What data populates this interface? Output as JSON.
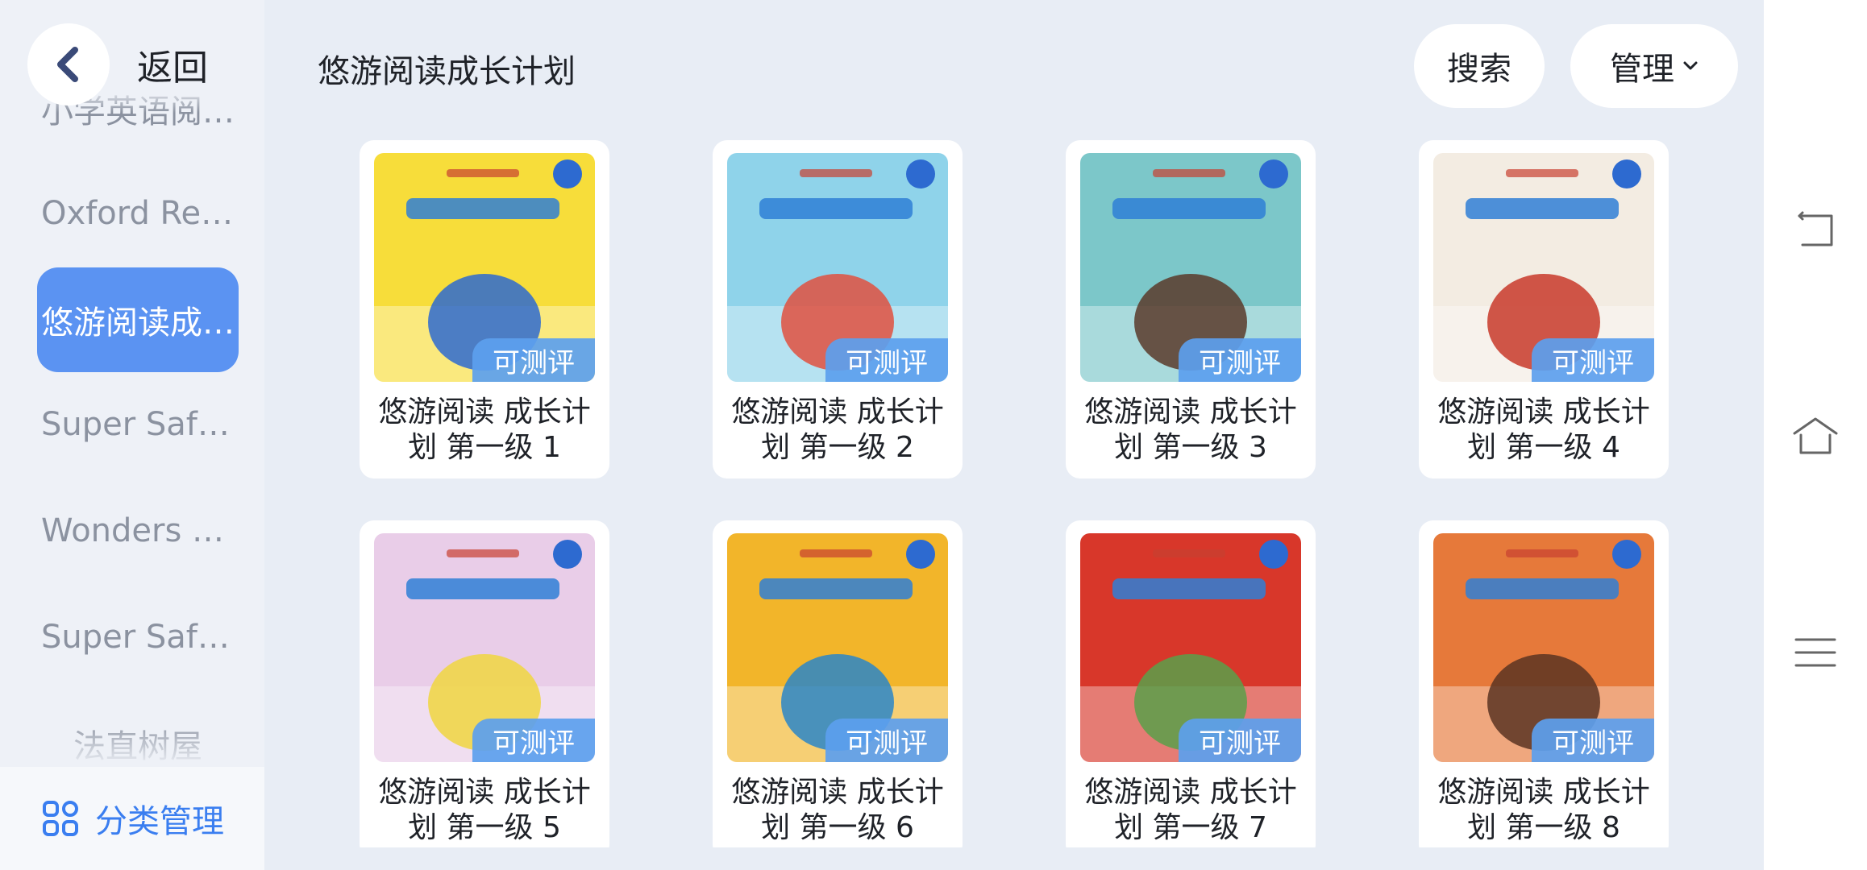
{
  "header": {
    "back_label": "返回",
    "title": "悠游阅读成长计划",
    "search_label": "搜索",
    "manage_label": "管理"
  },
  "sidebar": {
    "items": [
      {
        "label": "小学英语阅…"
      },
      {
        "label": "Oxford Rea…"
      },
      {
        "label": "悠游阅读成…",
        "active": true
      },
      {
        "label": "Super Safa…"
      },
      {
        "label": "Wonders R…"
      },
      {
        "label": "Super Safa…"
      },
      {
        "label": "法直树屋"
      }
    ],
    "manage_label": "分类管理"
  },
  "books": [
    {
      "title": "悠游阅读 成长计划 第一级 1",
      "badge": "可测评",
      "cover_bg": "#f7dd3a",
      "cover_accent": "#2d6ad0"
    },
    {
      "title": "悠游阅读 成长计划 第一级 2",
      "badge": "可测评",
      "cover_bg": "#8fd3ea",
      "cover_accent": "#e05040"
    },
    {
      "title": "悠游阅读 成长计划 第一级 3",
      "badge": "可测评",
      "cover_bg": "#7cc7c9",
      "cover_accent": "#5a3a2a"
    },
    {
      "title": "悠游阅读 成长计划 第一级 4",
      "badge": "可测评",
      "cover_bg": "#f3ece2",
      "cover_accent": "#c83a2a"
    },
    {
      "title": "悠游阅读 成长计划 第一级 5",
      "badge": "可测评",
      "cover_bg": "#e9cde8",
      "cover_accent": "#f0d640"
    },
    {
      "title": "悠游阅读 成长计划 第一级 6",
      "badge": "可测评",
      "cover_bg": "#f2b52a",
      "cover_accent": "#2a86c8"
    },
    {
      "title": "悠游阅读 成长计划 第一级 7",
      "badge": "可测评",
      "cover_bg": "#d8372a",
      "cover_accent": "#5aa04a"
    },
    {
      "title": "悠游阅读 成长计划 第一级 8",
      "badge": "可测评",
      "cover_bg": "#e6793a",
      "cover_accent": "#5a3422"
    }
  ],
  "colors": {
    "accent": "#5b93f2",
    "link_blue": "#3a7ef0",
    "badge": "#5ca0ee",
    "background": "#e8edf5"
  },
  "icons": {
    "back": "chevron-left-icon",
    "manage_dropdown": "chevron-down-icon",
    "category_manage": "grid-icon",
    "nav_back": "nav-back-icon",
    "nav_home": "nav-home-icon",
    "nav_menu": "nav-menu-icon"
  }
}
